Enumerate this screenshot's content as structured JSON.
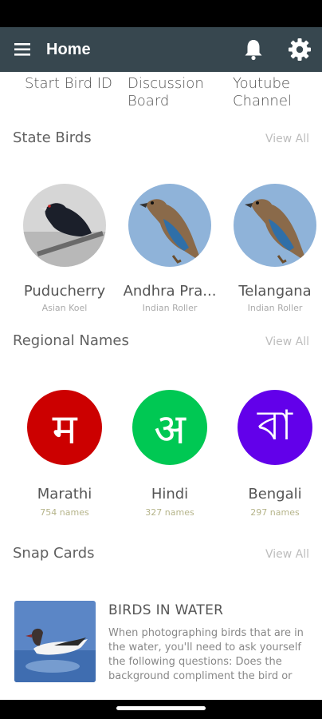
{
  "header": {
    "title": "Home",
    "icons": {
      "menu": "hamburger-menu-icon",
      "notifications": "bell-icon",
      "settings": "gear-icon"
    }
  },
  "shortcuts": [
    {
      "label": "Start Bird ID"
    },
    {
      "label": "Discussion\nBoard"
    },
    {
      "label": "Youtube\nChannel"
    }
  ],
  "state_birds": {
    "title": "State Birds",
    "view_all": "View All",
    "items": [
      {
        "state": "Puducherry",
        "species": "Asian Koel"
      },
      {
        "state": "Andhra Pra...",
        "species": "Indian Roller"
      },
      {
        "state": "Telangana",
        "species": "Indian Roller"
      }
    ]
  },
  "regional_names": {
    "title": "Regional Names",
    "view_all": "View All",
    "items": [
      {
        "glyph": "म",
        "language": "Marathi",
        "count": "754 names",
        "color": "#cc0000"
      },
      {
        "glyph": "अ",
        "language": "Hindi",
        "count": "327 names",
        "color": "#00c853"
      },
      {
        "glyph": "বা",
        "language": "Bengali",
        "count": "297 names",
        "color": "#6200ea"
      }
    ]
  },
  "snap_cards": {
    "title": "Snap Cards",
    "view_all": "View All",
    "card": {
      "title": "BIRDS IN WATER",
      "body": "When photographing birds that are in the water, you'll need to ask yourself the following questions: Does the background compliment the bird or"
    }
  },
  "colors": {
    "app_bar": "#37474f",
    "background": "#ffffff"
  }
}
